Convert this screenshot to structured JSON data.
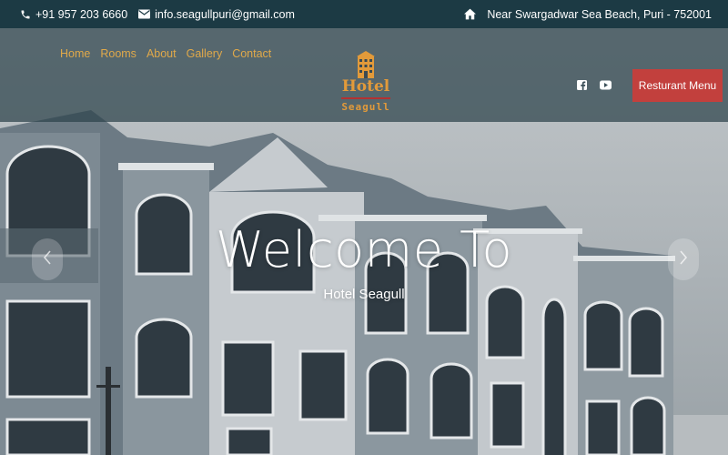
{
  "topbar": {
    "phone": "+91 957 203 6660",
    "email": "info.seagullpuri@gmail.com",
    "address": "Near Swargadwar Sea Beach, Puri - 752001"
  },
  "nav": {
    "items": [
      {
        "label": "Home"
      },
      {
        "label": "Rooms"
      },
      {
        "label": "About"
      },
      {
        "label": "Gallery"
      },
      {
        "label": "Contact"
      }
    ]
  },
  "logo": {
    "line1": "Hotel",
    "line2": "Seagull"
  },
  "header": {
    "menu_button": "Resturant Menu",
    "social": [
      "facebook-icon",
      "youtube-icon"
    ]
  },
  "hero": {
    "title": "Welcome To",
    "subtitle": "Hotel Seagull"
  },
  "colors": {
    "topbar_bg": "#1c3a44",
    "nav_link": "#e0a94a",
    "logo": "#e29a3a",
    "button": "#c2403d"
  }
}
